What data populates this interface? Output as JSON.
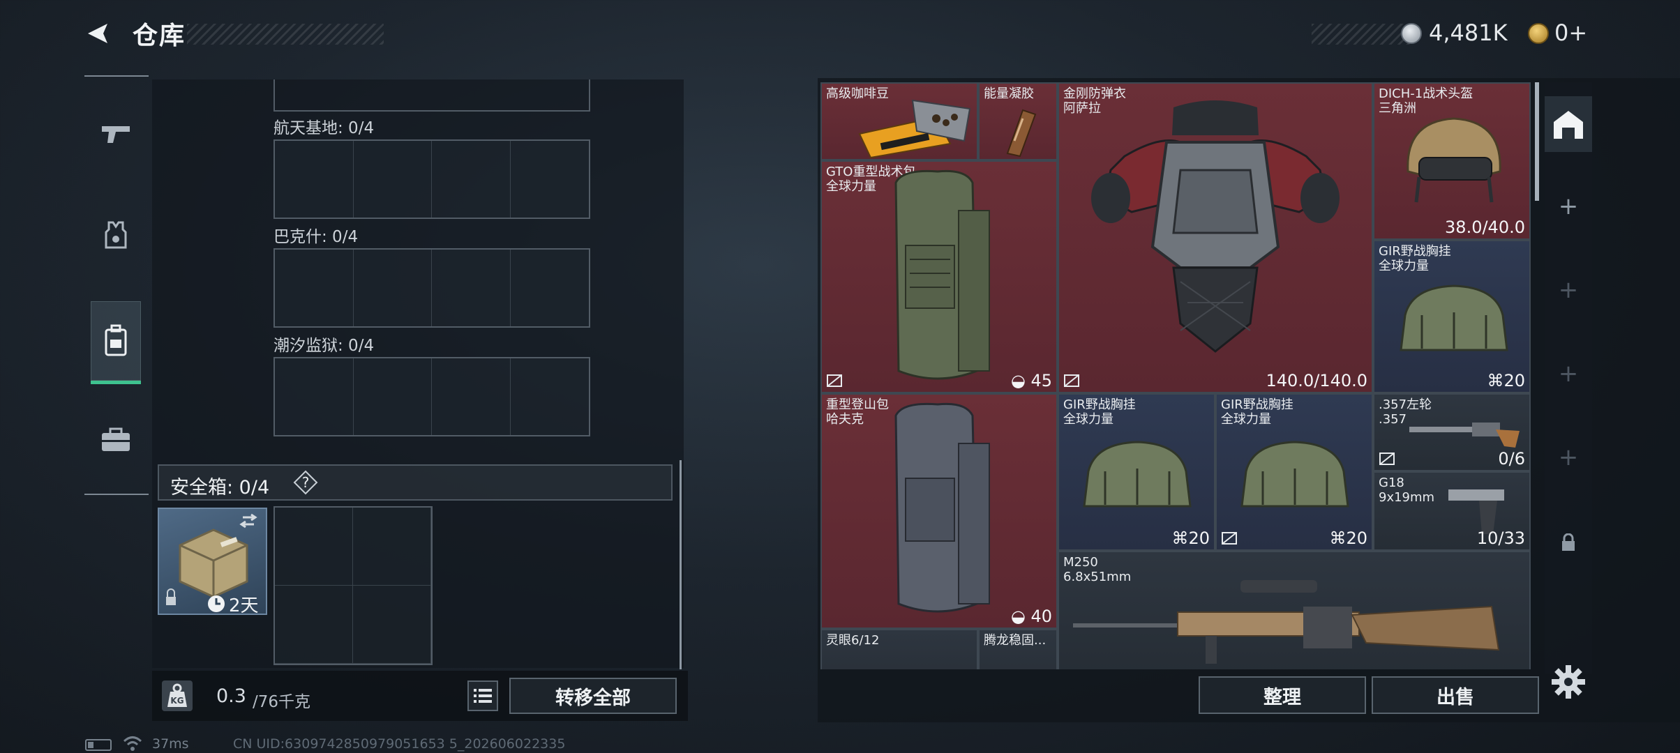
{
  "header": {
    "title": "仓库",
    "currency": {
      "coins": "4,481K",
      "gold": "0+"
    }
  },
  "left_rail": {
    "categories": [
      "weapons",
      "gear",
      "backpacks",
      "equipment-case"
    ],
    "active": "backpacks"
  },
  "storage": {
    "zones": [
      {
        "label": "航天基地: 0/4"
      },
      {
        "label": "巴克什: 0/4"
      },
      {
        "label": "潮汐监狱: 0/4"
      }
    ],
    "safe_box": {
      "label": "安全箱:  0/4",
      "help": "?",
      "duration": "2天"
    },
    "weight": {
      "value": "0.3",
      "unit": "/76千克"
    },
    "transfer_all": "转移全部"
  },
  "status_bar": {
    "ping": "37ms",
    "uid": "CN UID:6309742850979051653 5_202606022335"
  },
  "inventory": {
    "items": [
      {
        "name": "高级咖啡豆",
        "sub": "",
        "value": "",
        "color": "red"
      },
      {
        "name": "能量凝胶",
        "sub": "",
        "value": "",
        "color": "red"
      },
      {
        "name": "金刚防弹衣",
        "sub": "阿萨拉",
        "value": "140.0/140.0",
        "color": "red"
      },
      {
        "name": "DICH-1战术头盔",
        "sub": "三角洲",
        "value": "38.0/40.0",
        "color": "red"
      },
      {
        "name": "GTO重型战术包",
        "sub": "全球力量",
        "value": "45",
        "color": "red"
      },
      {
        "name": "GIR野战胸挂",
        "sub": "全球力量",
        "value": "20",
        "color": "blue"
      },
      {
        "name": "重型登山包",
        "sub": "哈夫克",
        "value": "40",
        "color": "red"
      },
      {
        "name": "GIR野战胸挂",
        "sub": "全球力量",
        "value": "20",
        "color": "blue"
      },
      {
        "name": "GIR野战胸挂",
        "sub": "全球力量",
        "value": "20",
        "color": "blue"
      },
      {
        "name": ".357左轮",
        "sub": ".357",
        "value": "0/6",
        "color": "gray"
      },
      {
        "name": "G18",
        "sub": "9x19mm",
        "value": "10/33",
        "color": "gray"
      },
      {
        "name": "M250",
        "sub": "6.8x51mm",
        "value": "",
        "color": "gray"
      },
      {
        "name": "灵眼6/12",
        "sub": "",
        "value": "",
        "color": "gray"
      },
      {
        "name": "腾龙稳固...",
        "sub": "",
        "value": "",
        "color": "gray"
      }
    ],
    "sort_label": "整理",
    "sell_label": "出售"
  },
  "right_rail": {
    "tabs": [
      "home-tab",
      "add",
      "add",
      "add",
      "add",
      "locked"
    ]
  },
  "colors": {
    "accent": "#3ec28f",
    "red_item": "#6a2f37",
    "blue_item": "#2f3a52"
  }
}
